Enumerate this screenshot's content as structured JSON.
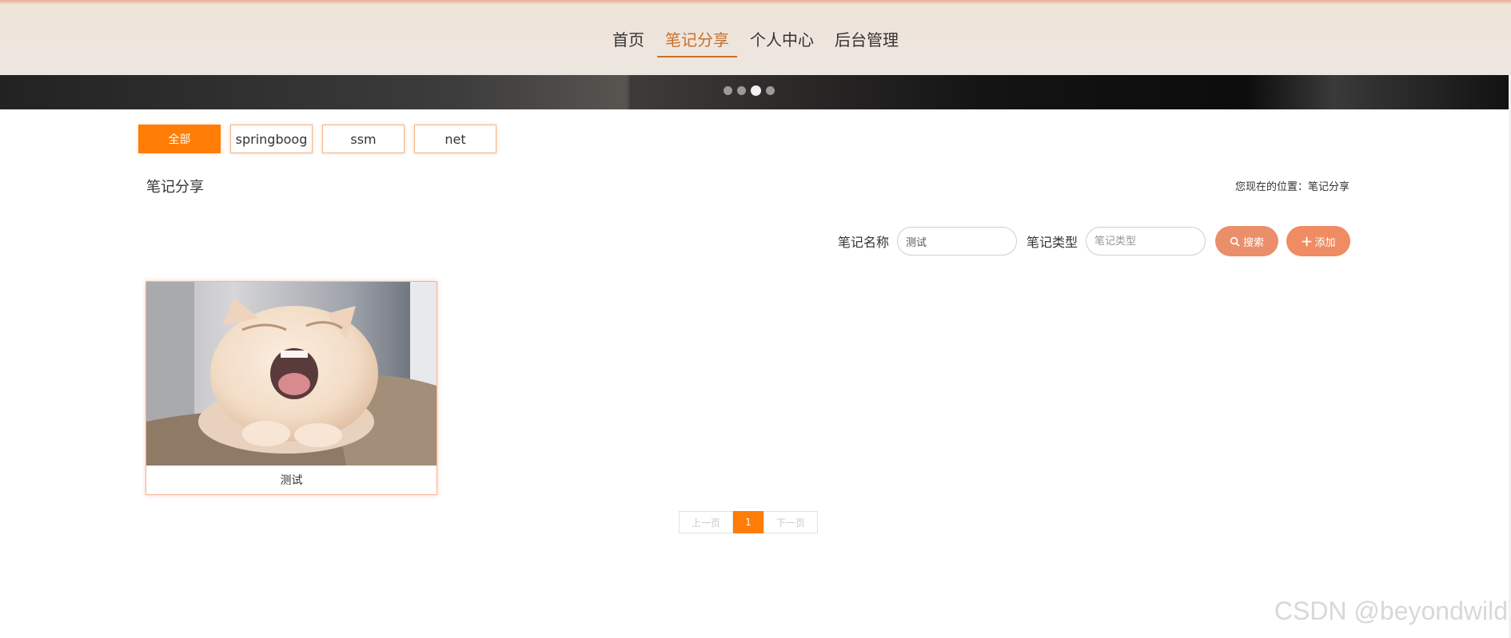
{
  "nav": {
    "items": [
      {
        "label": "首页"
      },
      {
        "label": "笔记分享",
        "active": true
      },
      {
        "label": "个人中心"
      },
      {
        "label": "后台管理"
      }
    ]
  },
  "banner": {
    "slide_count": 4,
    "active_slide": 3
  },
  "categories": [
    {
      "label": "全部",
      "active": true
    },
    {
      "label": "springboog"
    },
    {
      "label": "ssm"
    },
    {
      "label": "net"
    }
  ],
  "page": {
    "title": "笔记分享",
    "location": "您现在的位置：笔记分享"
  },
  "search": {
    "name_label": "笔记名称",
    "name_value": "测试",
    "type_label": "笔记类型",
    "type_placeholder": "笔记类型",
    "search_button": "搜索",
    "add_button": "添加"
  },
  "cards": [
    {
      "title": "测试",
      "image": "yawning-cat-photo"
    }
  ],
  "pagination": {
    "prev": "上一页",
    "current": "1",
    "next": "下一页"
  },
  "watermark": "CSDN @beyondwild",
  "colors": {
    "accent": "#ff7d06",
    "nav_active": "#c8702a",
    "button": "#ef8c63"
  }
}
